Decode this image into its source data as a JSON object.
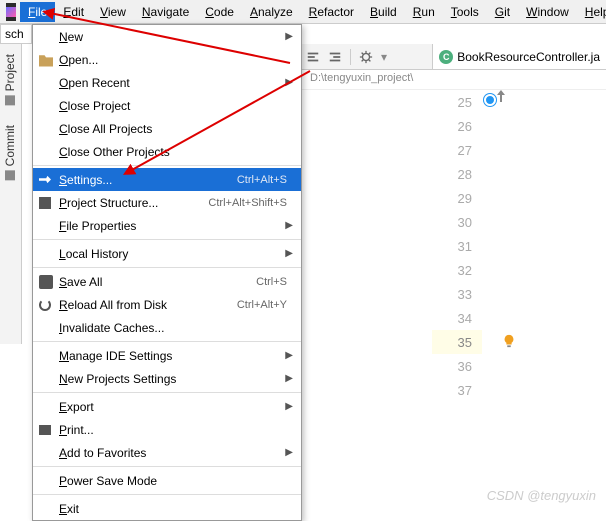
{
  "menubar": {
    "items": [
      "File",
      "Edit",
      "View",
      "Navigate",
      "Code",
      "Analyze",
      "Refactor",
      "Build",
      "Run",
      "Tools",
      "Git",
      "Window",
      "Help"
    ],
    "active": "File"
  },
  "sch_label": "sch",
  "side_tabs": {
    "project": "Project",
    "commit": "Commit"
  },
  "dropdown": [
    {
      "type": "item",
      "label": "New",
      "submenu": true
    },
    {
      "type": "item",
      "label": "Open...",
      "icon": "folder"
    },
    {
      "type": "item",
      "label": "Open Recent",
      "submenu": true
    },
    {
      "type": "item",
      "label": "Close Project"
    },
    {
      "type": "item",
      "label": "Close All Projects"
    },
    {
      "type": "item",
      "label": "Close Other Projects"
    },
    {
      "type": "sep"
    },
    {
      "type": "item",
      "label": "Settings...",
      "icon": "wrench",
      "shortcut": "Ctrl+Alt+S",
      "selected": true
    },
    {
      "type": "item",
      "label": "Project Structure...",
      "icon": "struct",
      "shortcut": "Ctrl+Alt+Shift+S"
    },
    {
      "type": "item",
      "label": "File Properties",
      "submenu": true
    },
    {
      "type": "sep"
    },
    {
      "type": "item",
      "label": "Local History",
      "submenu": true
    },
    {
      "type": "sep"
    },
    {
      "type": "item",
      "label": "Save All",
      "icon": "save",
      "shortcut": "Ctrl+S"
    },
    {
      "type": "item",
      "label": "Reload All from Disk",
      "icon": "reload",
      "shortcut": "Ctrl+Alt+Y"
    },
    {
      "type": "item",
      "label": "Invalidate Caches..."
    },
    {
      "type": "sep"
    },
    {
      "type": "item",
      "label": "Manage IDE Settings",
      "submenu": true
    },
    {
      "type": "item",
      "label": "New Projects Settings",
      "submenu": true
    },
    {
      "type": "sep"
    },
    {
      "type": "item",
      "label": "Export",
      "submenu": true
    },
    {
      "type": "item",
      "label": "Print...",
      "icon": "print"
    },
    {
      "type": "item",
      "label": "Add to Favorites",
      "submenu": true
    },
    {
      "type": "sep"
    },
    {
      "type": "item",
      "label": "Power Save Mode"
    },
    {
      "type": "sep"
    },
    {
      "type": "item",
      "label": "Exit"
    }
  ],
  "breadcrumb": "D:\\tengyuxin_project\\",
  "editor_tab": {
    "icon": "C",
    "name": "BookResourceController.ja"
  },
  "line_numbers": [
    25,
    26,
    27,
    28,
    29,
    30,
    31,
    32,
    33,
    34,
    35,
    36,
    37
  ],
  "highlighted_line": 35,
  "marker_line": 25,
  "watermark": "CSDN @tengyuxin"
}
